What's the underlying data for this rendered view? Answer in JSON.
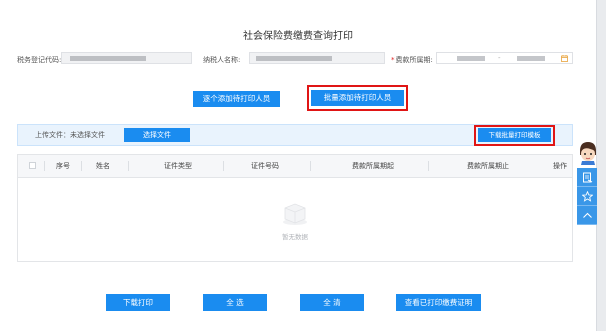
{
  "page": {
    "title": "社会保险费缴费查询打印"
  },
  "form": {
    "tax_code_label": "税务登记代码:",
    "taxpayer_name_label": "纳税人名称:",
    "period_label": "费款所属期:",
    "period_separator": "-"
  },
  "actions": {
    "add_one": "逐个添加待打印人员",
    "add_batch": "批量添加待打印人员"
  },
  "upload": {
    "label": "上传文件：未选择文件",
    "choose_file": "选择文件",
    "download_template": "下载批量打印模板"
  },
  "table": {
    "columns": [
      "序号",
      "姓名",
      "证件类型",
      "证件号码",
      "费款所属期起",
      "费款所属期止",
      "操作"
    ],
    "empty_text": "暂无数据"
  },
  "footer": {
    "download_print": "下载打印",
    "select_all": "全 选",
    "clear_all": "全 清",
    "view_printed": "查看已打印缴费证明"
  },
  "colors": {
    "primary": "#1a8cf0",
    "highlight": "#e01515"
  },
  "icons": [
    "calendar-icon",
    "avatar-icon",
    "document-icon",
    "star-icon",
    "up-arrow-icon"
  ]
}
